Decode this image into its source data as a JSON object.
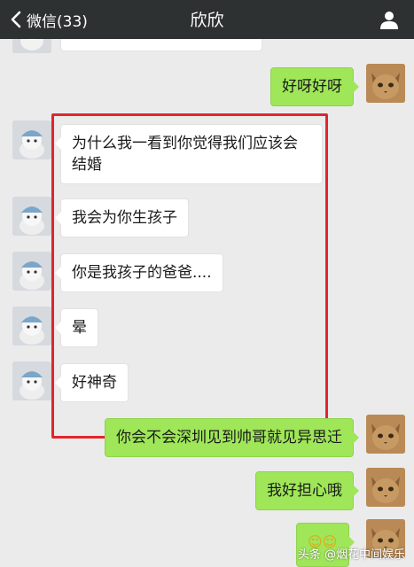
{
  "nav": {
    "back_label": "微信(33)",
    "title": "欣欣"
  },
  "messages": [
    {
      "side": "right",
      "text": "好呀好呀"
    },
    {
      "side": "left",
      "text": "为什么我一看到你觉得我们应该会结婚"
    },
    {
      "side": "left",
      "text": "我会为你生孩子"
    },
    {
      "side": "left",
      "text": "你是我孩子的爸爸...."
    },
    {
      "side": "left",
      "text": "晕"
    },
    {
      "side": "left",
      "text": "好神奇"
    },
    {
      "side": "right",
      "text": "你会不会深圳见到帅哥就见异思迁"
    },
    {
      "side": "right",
      "text": "我好担心哦"
    }
  ],
  "watermark": "头条 @烟花中间娱乐",
  "colors": {
    "navbar": "#2e3132",
    "chat_background": "#ebebeb",
    "incoming_bubble": "#ffffff",
    "outgoing_bubble": "#9fe658",
    "highlight_border": "#e0262c"
  },
  "icons": {
    "back": "chevron-left-icon",
    "profile": "person-icon",
    "contact_avatar": "cat-avatar",
    "my_avatar": "cat-photo-avatar"
  }
}
